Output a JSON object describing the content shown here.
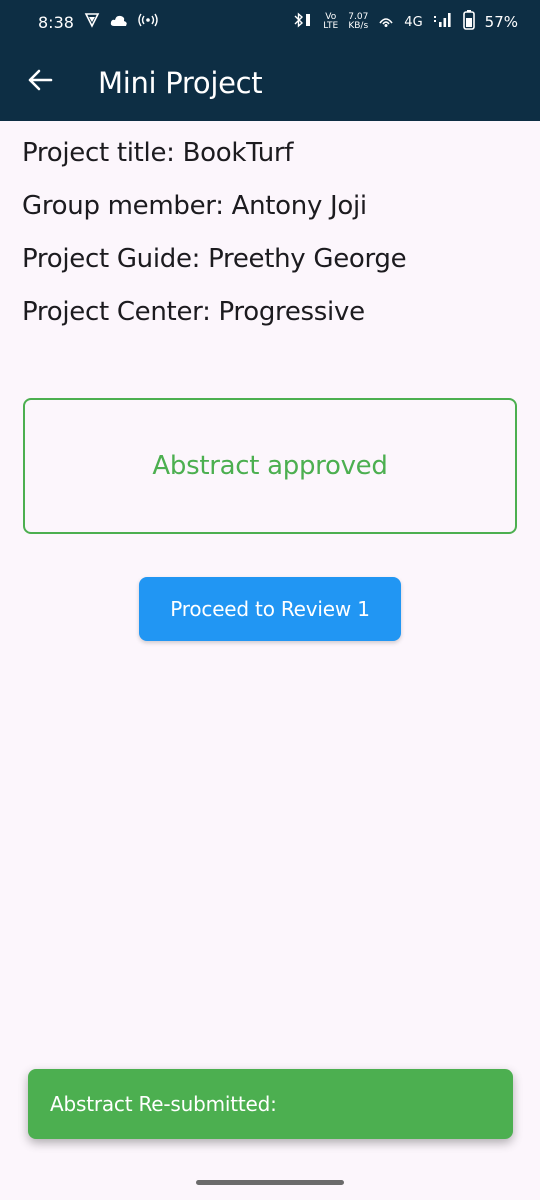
{
  "status_bar": {
    "time": "8:38",
    "volte_top": "Vo",
    "volte_bottom": "LTE",
    "speed_top": "7.07",
    "speed_bottom": "KB/s",
    "network": "4G",
    "battery": "57%",
    "icons": [
      "vpn-icon",
      "cloud-icon",
      "hotspot-icon",
      "bluetooth-icon",
      "volte-icon",
      "wifi-icon",
      "signal-icon",
      "battery-icon"
    ]
  },
  "app_bar": {
    "title": "Mini Project",
    "back_icon": "arrow-left-icon"
  },
  "project": {
    "title_line": "Project title: BookTurf",
    "member_line": "Group member: Antony Joji",
    "guide_line": "Project Guide: Preethy George",
    "center_line": "Project Center: Progressive"
  },
  "status": {
    "text": "Abstract approved",
    "color": "#4caf50"
  },
  "actions": {
    "proceed_label": "Proceed to Review 1",
    "color": "#2196f3"
  },
  "snackbar": {
    "text": "Abstract Re-submitted:",
    "color": "#4caf50"
  },
  "colors": {
    "header": "#0d2e44",
    "background": "#fcf6fc"
  }
}
